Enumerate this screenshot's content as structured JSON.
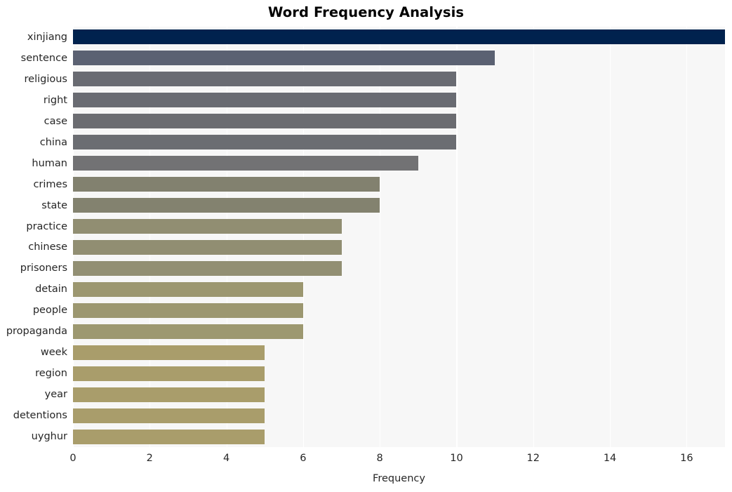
{
  "chart_data": {
    "type": "bar",
    "orientation": "horizontal",
    "title": "Word Frequency Analysis",
    "xlabel": "Frequency",
    "ylabel": "",
    "xlim": [
      0,
      17
    ],
    "ylim": [
      0,
      20
    ],
    "grid": true,
    "legend": null,
    "x_ticks": [
      0,
      2,
      4,
      6,
      8,
      10,
      12,
      14,
      16
    ],
    "x_tick_labels": [
      "0",
      "2",
      "4",
      "6",
      "8",
      "10",
      "12",
      "14",
      "16"
    ],
    "categories": [
      "xinjiang",
      "sentence",
      "religious",
      "right",
      "case",
      "china",
      "human",
      "crimes",
      "state",
      "practice",
      "chinese",
      "prisoners",
      "detain",
      "people",
      "propaganda",
      "week",
      "region",
      "year",
      "detentions",
      "uyghur"
    ],
    "values": [
      17,
      11,
      10,
      10,
      10,
      10,
      9,
      8,
      8,
      7,
      7,
      7,
      6,
      6,
      6,
      5,
      5,
      5,
      5,
      5
    ],
    "bar_colors": [
      "#00224e",
      "#5b6172",
      "#696b72",
      "#696b72",
      "#6b6c71",
      "#6b6d72",
      "#727274",
      "#82816f",
      "#83826f",
      "#918e72",
      "#918e72",
      "#928f73",
      "#9c9770",
      "#9c9770",
      "#9d9870",
      "#a99d6b",
      "#a99d6b",
      "#a99d6b",
      "#a99d6b",
      "#a99d6b"
    ],
    "plot_background": "#f7f7f7",
    "gridline_color": "#ffffff",
    "colormap": "cividis"
  }
}
